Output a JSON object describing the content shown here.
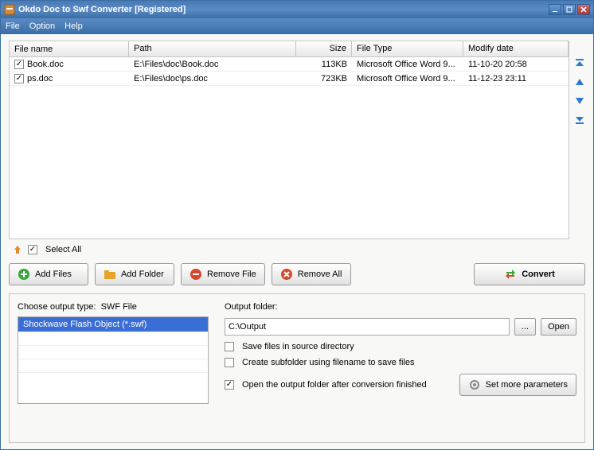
{
  "window": {
    "title": "Okdo Doc to Swf Converter [Registered]"
  },
  "menu": {
    "file": "File",
    "option": "Option",
    "help": "Help"
  },
  "columns": {
    "name": "File name",
    "path": "Path",
    "size": "Size",
    "type": "File Type",
    "date": "Modify date"
  },
  "files": [
    {
      "checked": true,
      "name": "Book.doc",
      "path": "E:\\Files\\doc\\Book.doc",
      "size": "113KB",
      "type": "Microsoft Office Word 9...",
      "date": "11-10-20 20:58"
    },
    {
      "checked": true,
      "name": "ps.doc",
      "path": "E:\\Files\\doc\\ps.doc",
      "size": "723KB",
      "type": "Microsoft Office Word 9...",
      "date": "11-12-23 23:11"
    }
  ],
  "selectAll": {
    "label": "Select All",
    "checked": true
  },
  "buttons": {
    "addFiles": "Add Files",
    "addFolder": "Add Folder",
    "removeFile": "Remove File",
    "removeAll": "Remove All",
    "convert": "Convert",
    "browse": "...",
    "open": "Open",
    "moreParams": "Set more parameters"
  },
  "output": {
    "typeLabel": "Choose output type:",
    "typeValue": "SWF File",
    "typeItem": "Shockwave Flash Object (*.swf)",
    "folderLabel": "Output folder:",
    "folderPath": "C:\\Output",
    "saveSource": "Save files in source directory",
    "createSubfolder": "Create subfolder using filename to save files",
    "openAfter": "Open the output folder after conversion finished",
    "saveSourceChecked": false,
    "createSubfolderChecked": false,
    "openAfterChecked": true
  }
}
